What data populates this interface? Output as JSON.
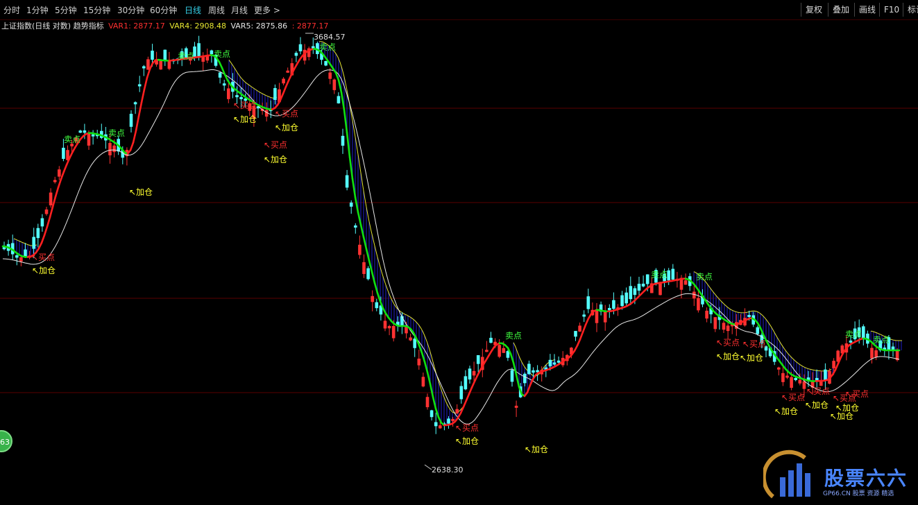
{
  "toolbar": {
    "periods": [
      "分时",
      "1分钟",
      "5分钟",
      "15分钟",
      "30分钟",
      "60分钟",
      "日线",
      "周线",
      "月线",
      "更多 >"
    ],
    "active_period": "日线",
    "right_buttons": [
      "复权",
      "叠加",
      "画线",
      "F10",
      "标记"
    ]
  },
  "indicator": {
    "title": "上证指数(日线 对数) 趋势指标",
    "var1_label": "VAR1:",
    "var1_value": "2877.17",
    "var4_label": "VAR4:",
    "var4_value": "2908.48",
    "var5_label": "VAR5:",
    "var5_value": "2875.86",
    "extra_value": ": 2877.17"
  },
  "chart_markers": {
    "high_label": "3684.57",
    "low_label": "2638.30",
    "sell_signal": "卖点",
    "buy_signal": "买点",
    "add_signal": "加仓",
    "arrow": "↖"
  },
  "badge": {
    "text": "63"
  },
  "colors": {
    "up": "#ff3232",
    "down": "#54ffff",
    "ma_fast_up": "#ff2020",
    "ma_fast_down": "#10e010",
    "ma_slow": "#e8e8e8",
    "band": "#1a1aa8",
    "band_edge": "#e0e030",
    "sell_text": "#40ff40",
    "buy_text": "#ff3030",
    "add_text": "#ffff30"
  },
  "watermark": {
    "title": "股票六六",
    "subtitle": "GP66.CN 股票 资源 精选"
  }
}
